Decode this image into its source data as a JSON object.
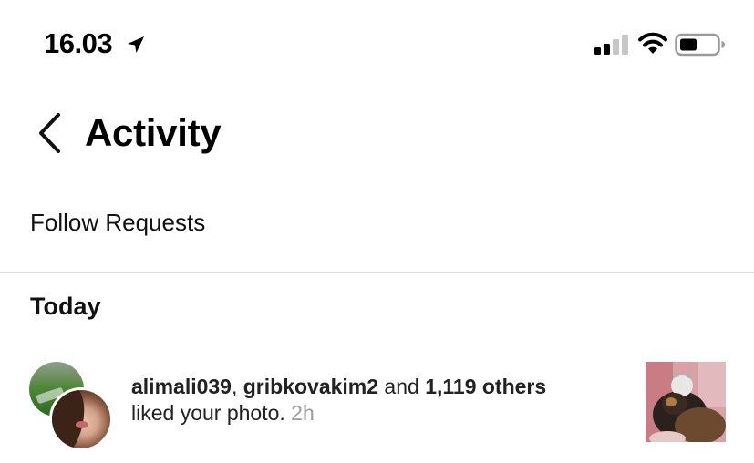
{
  "status_bar": {
    "time": "16.03",
    "location_icon": "location-arrow-icon",
    "signal_icon": "cellular-signal-icon",
    "wifi_icon": "wifi-icon",
    "battery_icon": "battery-icon"
  },
  "header": {
    "back_icon": "chevron-left-icon",
    "title": "Activity"
  },
  "follow_requests": {
    "label": "Follow Requests"
  },
  "sections": {
    "today": "Today"
  },
  "notification": {
    "user1": "alimali039",
    "separator": ", ",
    "user2": "gribkovakim2",
    "conjunction": " and ",
    "others": "1,119 others",
    "action": "liked your photo.",
    "time": "2h"
  }
}
